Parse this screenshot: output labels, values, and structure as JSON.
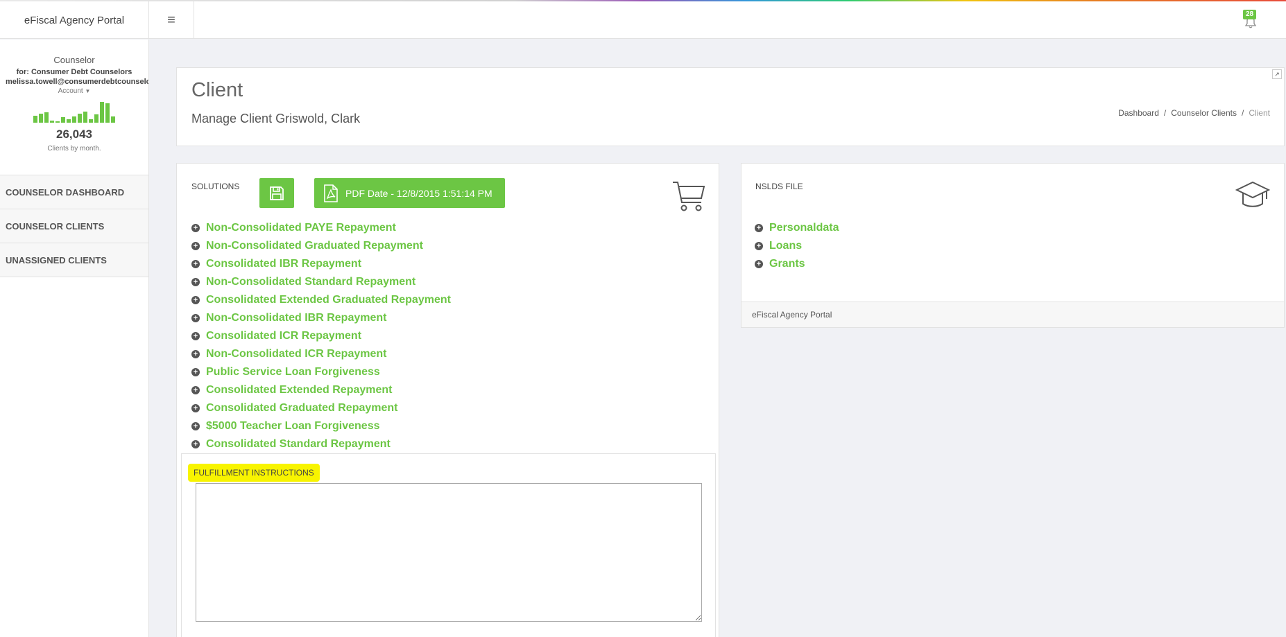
{
  "app": {
    "brand": "eFiscal Agency Portal",
    "notification_count": "28"
  },
  "sidebar": {
    "profile": {
      "role": "Counselor",
      "org": "for: Consumer Debt Counselors",
      "email": "melissa.towell@consumerdebtcounselors.com",
      "account_label": "Account",
      "clients_by_month": [
        9,
        11,
        13,
        3,
        1,
        7,
        4,
        8,
        11,
        14,
        4,
        10,
        26,
        24,
        8
      ],
      "count": "26,043",
      "caption": "Clients by month."
    },
    "nav": [
      {
        "label": "COUNSELOR DASHBOARD"
      },
      {
        "label": "COUNSELOR CLIENTS"
      },
      {
        "label": "UNASSIGNED CLIENTS"
      }
    ]
  },
  "header": {
    "title": "Client",
    "subtitle": "Manage Client Griswold, Clark",
    "breadcrumb": [
      {
        "label": "Dashboard"
      },
      {
        "label": "Counselor Clients"
      },
      {
        "label": "Client"
      }
    ]
  },
  "solutions": {
    "label": "SOLUTIONS",
    "pdf_label": "PDF Date - 12/8/2015 1:51:14 PM",
    "items": [
      "Non-Consolidated PAYE Repayment",
      "Non-Consolidated Graduated Repayment",
      "Consolidated IBR Repayment",
      "Non-Consolidated Standard Repayment",
      "Consolidated Extended Graduated Repayment",
      "Non-Consolidated IBR Repayment",
      "Consolidated ICR Repayment",
      "Non-Consolidated ICR Repayment",
      "Public Service Loan Forgiveness",
      "Consolidated Extended Repayment",
      "Consolidated Graduated Repayment",
      "$5000 Teacher Loan Forgiveness",
      "Consolidated Standard Repayment"
    ],
    "fulfillment_label": "FULFILLMENT INSTRUCTIONS",
    "fulfillment_value": ""
  },
  "nslds": {
    "label": "NSLDS FILE",
    "items": [
      "Personaldata",
      "Loans",
      "Grants"
    ],
    "footer": "eFiscal Agency Portal"
  },
  "colors": {
    "accent": "#6cc644",
    "highlight": "#f8f400"
  },
  "icons": {
    "menu": "hamburger-icon",
    "notifications": "bell-icon",
    "save": "floppy-disk-icon",
    "pdf": "pdf-file-icon",
    "cart": "shopping-cart-icon",
    "nslds": "graduation-cap-icon",
    "expand": "expand-icon",
    "list_item": "plus-circle-icon"
  }
}
